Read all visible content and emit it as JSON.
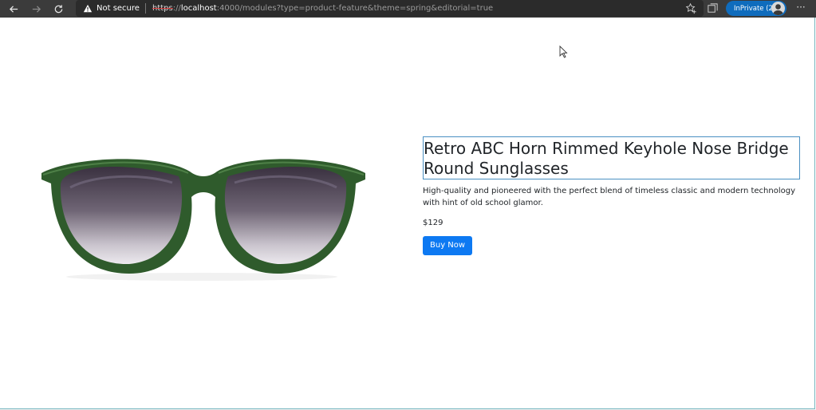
{
  "browser": {
    "security_label": "Not secure",
    "url_scheme": "https",
    "url_host": "localhost",
    "url_rest": ":4000/modules?type=product-feature&theme=spring&editorial=true",
    "inprivate_label": "InPrivate (2)",
    "accent_color": "#0f6cbd"
  },
  "product": {
    "title": "Retro ABC Horn Rimmed Keyhole Nose Bridge Round Sunglasses",
    "description": "High-quality and pioneered with the perfect blend of timeless classic and modern technology with hint of old school glamor.",
    "price": "$129",
    "buy_label": "Buy Now",
    "button_color": "#0d79f2"
  }
}
